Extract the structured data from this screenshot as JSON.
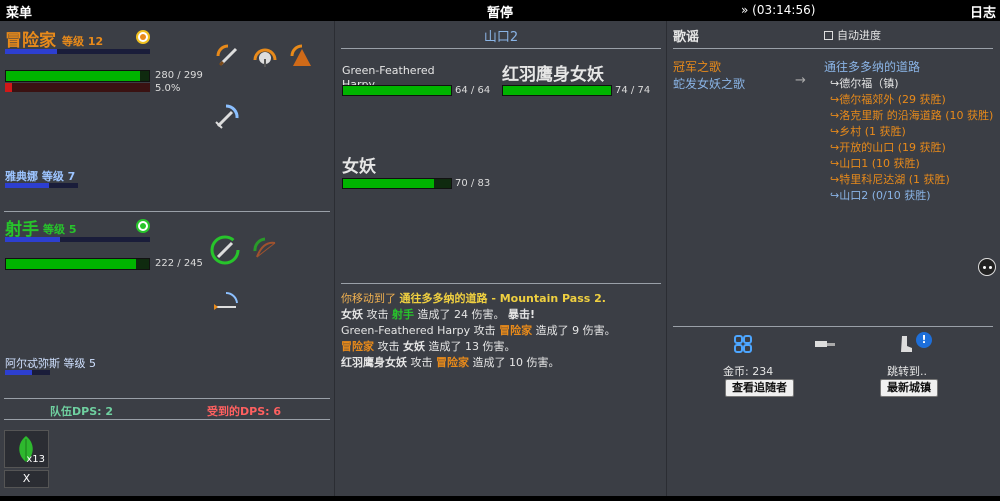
{
  "topbar": {
    "menu": "菜单",
    "pause": "暂停",
    "time": "» (03:14:56)",
    "log": "日志"
  },
  "party": [
    {
      "name": "冒险家",
      "level": "等级 12",
      "hp_text": "280 / 299",
      "hp_frac": 0.936,
      "xp_frac": 0.36,
      "percent": "5.0%",
      "red_frac": 0.05
    },
    {
      "name": "射手",
      "level": "等级 5",
      "hp_text": "222 / 245",
      "hp_frac": 0.906,
      "xp_frac": 0.38
    }
  ],
  "followers": [
    {
      "name": "雅典娜",
      "level": "等级 7",
      "xp_frac": 0.6
    },
    {
      "name": "阿尔忒弥斯",
      "level": "等级 5",
      "xp_frac": 0.6
    }
  ],
  "dps": {
    "party": "队伍DPS: 2",
    "taken": "受到的DPS: 6"
  },
  "inventory": {
    "count": "x13",
    "close": "X"
  },
  "battle": {
    "location": "山口2",
    "enemies": [
      {
        "name": "Green-Feathered Harpy",
        "hp_text": "64 / 64",
        "hp_frac": 1.0
      },
      {
        "name": "红羽鹰身女妖",
        "hp_text": "74 / 74",
        "hp_frac": 1.0
      },
      {
        "name": "女妖",
        "hp_text": "70 / 83",
        "hp_frac": 0.843
      }
    ]
  },
  "log": {
    "l1_pre": "你移动到了 ",
    "l1_loc": "通往多多纳的道路 - Mountain Pass 2.",
    "l2_a": "女妖",
    "l2_b": " 攻击 ",
    "l2_c": "射手",
    "l2_d": " 造成了 24 伤害。 ",
    "l2_e": "暴击!",
    "l3_a": "Green-Feathered Harpy",
    "l3_b": " 攻击 ",
    "l3_c": "冒险家",
    "l3_d": " 造成了 9 伤害。",
    "l4_a": "冒险家",
    "l4_b": " 攻击 ",
    "l4_c": "女妖",
    "l4_d": " 造成了 13 伤害。",
    "l5_a": "红羽鹰身女妖",
    "l5_b": " 攻击 ",
    "l5_c": "冒险家",
    "l5_d": " 造成了 10 伤害。"
  },
  "songs": {
    "title": "歌谣",
    "auto_progress": "自动进度",
    "items": [
      "冠军之歌",
      "蛇发女妖之歌"
    ],
    "arrow": "→"
  },
  "quest": {
    "title": "通往多多纳的道路",
    "items": [
      "↪德尔福（镇)",
      "↪德尔福郊外 (29 获胜)",
      "↪洛克里斯 的沿海道路 (10 获胜)",
      "↪乡村 (1 获胜)",
      "↪开放的山口 (19 获胜)",
      "↪山口1 (10 获胜)",
      "↪特里科尼达湖 (1 获胜)",
      "↪山口2 (0/10 获胜)"
    ]
  },
  "bottom": {
    "gold": "金币:  234",
    "view_followers": "查看追随者",
    "jump_to": "跳转到..",
    "newest_town": "最新城镇"
  }
}
